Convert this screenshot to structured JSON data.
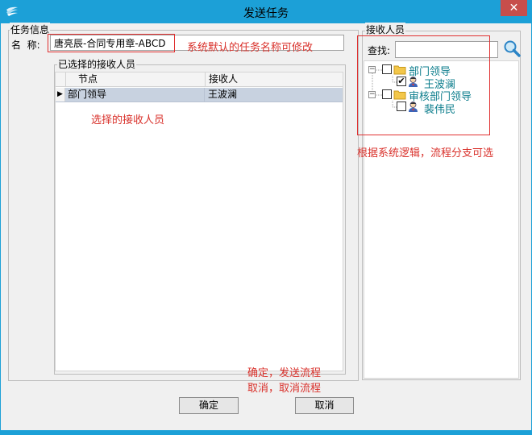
{
  "window": {
    "title": "发送任务",
    "close_glyph": "✕"
  },
  "task_info": {
    "group_title": "任务信息",
    "name_label": "名  称:",
    "name_value": "唐亮辰-合同专用章-ABCD"
  },
  "selected": {
    "group_title": "已选择的接收人员",
    "columns": [
      "节点",
      "接收人"
    ],
    "rows": [
      {
        "indicator": "▶",
        "node": "部门领导",
        "receiver": "王波澜"
      }
    ]
  },
  "receivers": {
    "group_title": "接收人员",
    "search_label": "查找:",
    "search_value": "",
    "tree": [
      {
        "label": "部门领导",
        "checked": false,
        "expander": "−",
        "children": [
          {
            "label": "王波澜",
            "checked": true
          }
        ]
      },
      {
        "label": "审核部门领导",
        "checked": false,
        "expander": "−",
        "children": [
          {
            "label": "裴伟民",
            "checked": false
          }
        ]
      }
    ]
  },
  "buttons": {
    "ok": "确定",
    "cancel": "取消"
  },
  "annotations": {
    "name_note": "系统默认的任务名称可修改",
    "selected_note": "选择的接收人员",
    "tree_note": "根据系统逻辑，流程分支可选",
    "ok_note": "确定，发送流程",
    "cancel_note": "取消，取消流程"
  },
  "colors": {
    "titlebar": "#1ca0d7",
    "annotation": "#d9312b",
    "tree_text": "#0c7d8c"
  }
}
